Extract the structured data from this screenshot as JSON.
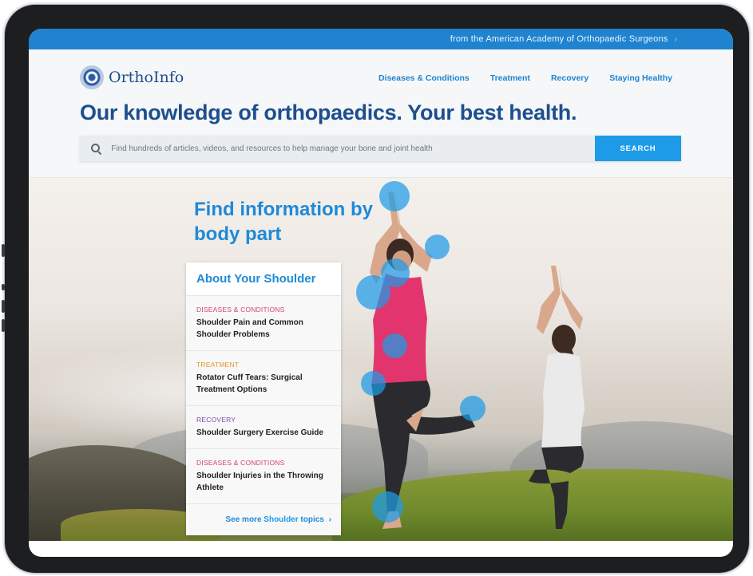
{
  "topbar": {
    "text": "from the American Academy of Orthopaedic Surgeons",
    "chevron": "›"
  },
  "brand": {
    "name": "OrthoInfo"
  },
  "nav": [
    {
      "label": "Diseases & Conditions"
    },
    {
      "label": "Treatment"
    },
    {
      "label": "Recovery"
    },
    {
      "label": "Staying Healthy"
    }
  ],
  "headline": "Our knowledge of orthopaedics. Your best health.",
  "search": {
    "placeholder": "Find hundreds of articles, videos, and resources to help manage your bone and joint health",
    "button": "SEARCH"
  },
  "hero": {
    "title": "Find information by body part",
    "panel_title": "About Your Shoulder",
    "topics": [
      {
        "category": "DISEASES & CONDITIONS",
        "category_color": "#d6407a",
        "title": "Shoulder Pain and Common Shoulder Problems"
      },
      {
        "category": "TREATMENT",
        "category_color": "#e8922a",
        "title": "Rotator Cuff Tears: Surgical Treatment Options"
      },
      {
        "category": "RECOVERY",
        "category_color": "#7a4fb0",
        "title": "Shoulder Surgery Exercise Guide"
      },
      {
        "category": "DISEASES & CONDITIONS",
        "category_color": "#d6407a",
        "title": "Shoulder Injuries in the Throwing Athlete"
      }
    ],
    "see_more_prefix": "See more ",
    "see_more_highlight": "Shoulder",
    "see_more_suffix": " topics",
    "see_more_chevron": "›",
    "body_part_markers": [
      "hand",
      "elbow",
      "neck",
      "shoulder",
      "spine",
      "hip",
      "knee",
      "foot"
    ]
  },
  "colors": {
    "topbar": "#1f83d0",
    "brand_dark": "#1e4e8e",
    "accent": "#1e9be8"
  }
}
